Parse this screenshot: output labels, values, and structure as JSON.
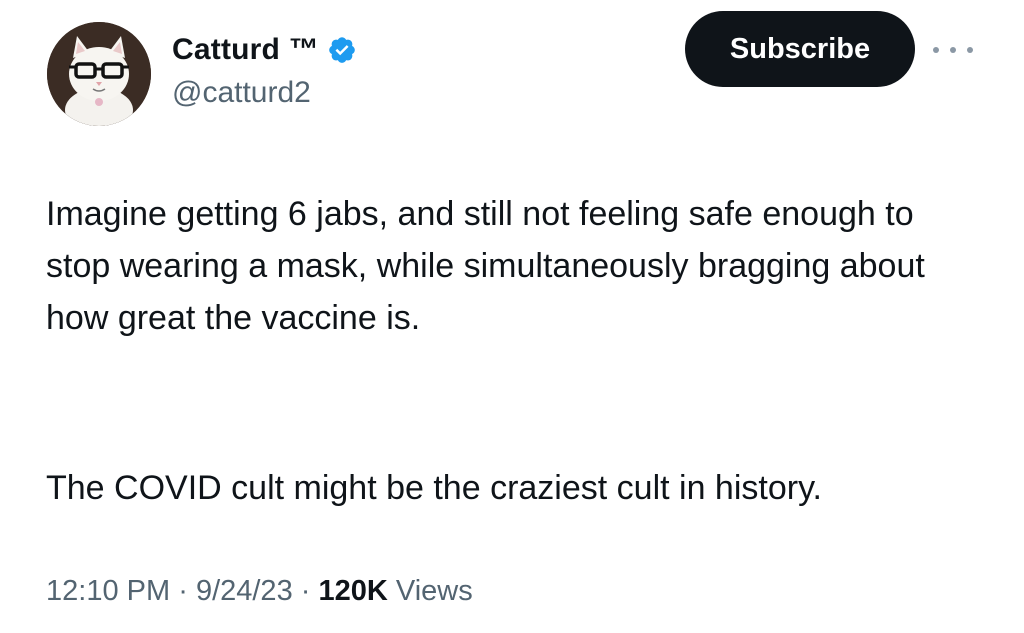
{
  "author": {
    "display_name": "Catturd ™",
    "handle": "@catturd2",
    "avatar_icon": "cat-with-glasses-avatar",
    "verified_icon": "verified-badge-icon",
    "verified_color": "#1d9bf0"
  },
  "actions": {
    "subscribe_label": "Subscribe",
    "more_icon": "more-options-icon"
  },
  "tweet": {
    "paragraph_1": "Imagine getting 6 jabs, and still not feeling safe enough to stop wearing a mask, while simultaneously bragging about how great the vaccine is.",
    "paragraph_2": "The COVID cult might be the craziest cult in history."
  },
  "meta": {
    "time": "12:10 PM",
    "separator": "·",
    "date": "9/24/23",
    "views_count": "120K",
    "views_label": "Views"
  },
  "colors": {
    "text": "#0f1419",
    "secondary": "#536471",
    "button_bg": "#0f1419"
  }
}
